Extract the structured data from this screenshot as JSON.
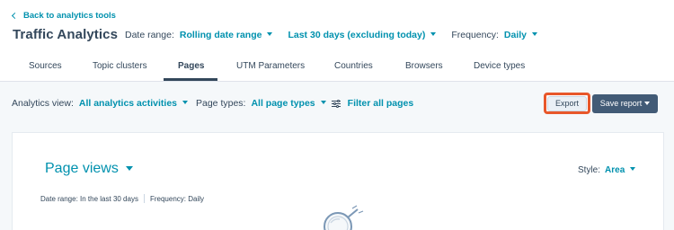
{
  "header": {
    "back_link": "Back to analytics tools",
    "title": "Traffic Analytics",
    "date_range_label": "Date range:",
    "date_range_value": "Rolling date range",
    "period_value": "Last 30 days (excluding today)",
    "frequency_label": "Frequency:",
    "frequency_value": "Daily"
  },
  "tabs": [
    {
      "label": "Sources"
    },
    {
      "label": "Topic clusters"
    },
    {
      "label": "Pages",
      "active": true
    },
    {
      "label": "UTM Parameters"
    },
    {
      "label": "Countries"
    },
    {
      "label": "Browsers"
    },
    {
      "label": "Device types"
    }
  ],
  "toolbar": {
    "analytics_view_label": "Analytics view:",
    "analytics_view_value": "All analytics activities",
    "page_types_label": "Page types:",
    "page_types_value": "All page types",
    "filter_label": "Filter all pages",
    "export_label": "Export",
    "save_report_label": "Save report"
  },
  "card": {
    "title": "Page views",
    "style_label": "Style:",
    "style_value": "Area",
    "meta_date_range": "Date range: In the last 30 days",
    "meta_frequency": "Frequency: Daily"
  },
  "colors": {
    "accent": "#0091ae",
    "text": "#33475b",
    "highlight": "#e8572a",
    "save_button": "#425b76",
    "background_gray": "#f5f8fa"
  },
  "icons": {
    "back": "chevron-left-icon",
    "filter": "sliders-icon",
    "empty_state": "magnifying-glass-icon"
  }
}
